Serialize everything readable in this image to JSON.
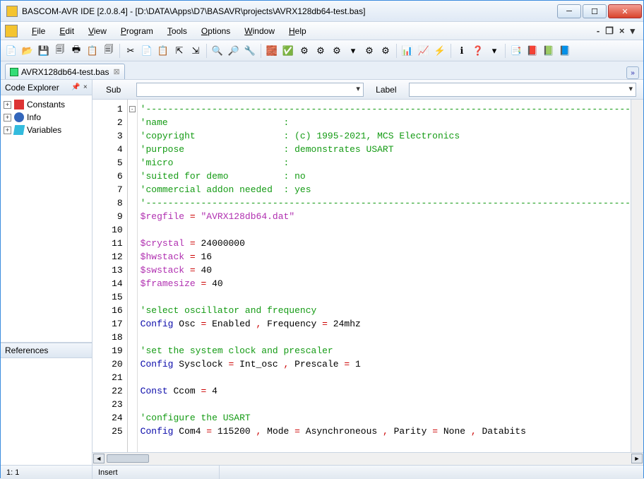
{
  "window": {
    "title": "BASCOM-AVR IDE [2.0.8.4] - [D:\\DATA\\Apps\\D7\\BASAVR\\projects\\AVRX128db64-test.bas]"
  },
  "menu": {
    "items": [
      "File",
      "Edit",
      "View",
      "Program",
      "Tools",
      "Options",
      "Window",
      "Help"
    ]
  },
  "tab": {
    "filename": "AVRX128db64-test.bas"
  },
  "explorer": {
    "title": "Code Explorer",
    "nodes": [
      "Constants",
      "Info",
      "Variables"
    ],
    "refs_title": "References"
  },
  "subbar": {
    "sub": "Sub",
    "label": "Label"
  },
  "code_lines": [
    {
      "n": 1,
      "seg": [
        {
          "t": "'----------------------------------------------------------------------------------------",
          "c": "c-comment"
        }
      ]
    },
    {
      "n": 2,
      "seg": [
        {
          "t": "'name                     :",
          "c": "c-comment"
        }
      ]
    },
    {
      "n": 3,
      "seg": [
        {
          "t": "'copyright                : (c) 1995-2021, MCS Electronics",
          "c": "c-comment"
        }
      ]
    },
    {
      "n": 4,
      "seg": [
        {
          "t": "'purpose                  : demonstrates USART",
          "c": "c-comment"
        }
      ]
    },
    {
      "n": 5,
      "seg": [
        {
          "t": "'micro                    :",
          "c": "c-comment"
        }
      ]
    },
    {
      "n": 6,
      "seg": [
        {
          "t": "'suited for demo          : no",
          "c": "c-comment"
        }
      ]
    },
    {
      "n": 7,
      "seg": [
        {
          "t": "'commercial addon needed  : yes",
          "c": "c-comment"
        }
      ]
    },
    {
      "n": 8,
      "seg": [
        {
          "t": "'----------------------------------------------------------------------------------------",
          "c": "c-comment"
        }
      ]
    },
    {
      "n": 9,
      "seg": [
        {
          "t": "$regfile",
          "c": "c-dir"
        },
        {
          "t": " = ",
          "c": "c-op"
        },
        {
          "t": "\"AVRX128db64.dat\"",
          "c": "c-str"
        }
      ]
    },
    {
      "n": 10,
      "seg": []
    },
    {
      "n": 11,
      "seg": [
        {
          "t": "$crystal",
          "c": "c-dir"
        },
        {
          "t": " = ",
          "c": "c-op"
        },
        {
          "t": "24000000",
          "c": "c-num"
        }
      ]
    },
    {
      "n": 12,
      "seg": [
        {
          "t": "$hwstack",
          "c": "c-dir"
        },
        {
          "t": " = ",
          "c": "c-op"
        },
        {
          "t": "16",
          "c": "c-num"
        }
      ]
    },
    {
      "n": 13,
      "seg": [
        {
          "t": "$swstack",
          "c": "c-dir"
        },
        {
          "t": " = ",
          "c": "c-op"
        },
        {
          "t": "40",
          "c": "c-num"
        }
      ]
    },
    {
      "n": 14,
      "seg": [
        {
          "t": "$framesize",
          "c": "c-dir"
        },
        {
          "t": " = ",
          "c": "c-op"
        },
        {
          "t": "40",
          "c": "c-num"
        }
      ]
    },
    {
      "n": 15,
      "seg": []
    },
    {
      "n": 16,
      "seg": [
        {
          "t": "'select oscillator and frequency",
          "c": "c-comment"
        }
      ]
    },
    {
      "n": 17,
      "seg": [
        {
          "t": "Config",
          "c": "c-kw"
        },
        {
          "t": " Osc ",
          "c": ""
        },
        {
          "t": "=",
          "c": "c-op"
        },
        {
          "t": " Enabled ",
          "c": ""
        },
        {
          "t": ",",
          "c": "c-op"
        },
        {
          "t": " Frequency ",
          "c": ""
        },
        {
          "t": "=",
          "c": "c-op"
        },
        {
          "t": " 24mhz",
          "c": ""
        }
      ]
    },
    {
      "n": 18,
      "seg": []
    },
    {
      "n": 19,
      "seg": [
        {
          "t": "'set the system clock and prescaler",
          "c": "c-comment"
        }
      ]
    },
    {
      "n": 20,
      "seg": [
        {
          "t": "Config",
          "c": "c-kw"
        },
        {
          "t": " Sysclock ",
          "c": ""
        },
        {
          "t": "=",
          "c": "c-op"
        },
        {
          "t": " Int_osc ",
          "c": ""
        },
        {
          "t": ",",
          "c": "c-op"
        },
        {
          "t": " Prescale ",
          "c": ""
        },
        {
          "t": "=",
          "c": "c-op"
        },
        {
          "t": " 1",
          "c": ""
        }
      ]
    },
    {
      "n": 21,
      "seg": []
    },
    {
      "n": 22,
      "seg": [
        {
          "t": "Const",
          "c": "c-kw"
        },
        {
          "t": " Ccom ",
          "c": ""
        },
        {
          "t": "=",
          "c": "c-op"
        },
        {
          "t": " 4",
          "c": ""
        }
      ]
    },
    {
      "n": 23,
      "seg": []
    },
    {
      "n": 24,
      "seg": [
        {
          "t": "'configure the USART",
          "c": "c-comment"
        }
      ]
    },
    {
      "n": 25,
      "seg": [
        {
          "t": "Config",
          "c": "c-kw"
        },
        {
          "t": " Com4 ",
          "c": ""
        },
        {
          "t": "=",
          "c": "c-op"
        },
        {
          "t": " 115200 ",
          "c": ""
        },
        {
          "t": ",",
          "c": "c-op"
        },
        {
          "t": " Mode ",
          "c": ""
        },
        {
          "t": "=",
          "c": "c-op"
        },
        {
          "t": " Asynchroneous ",
          "c": ""
        },
        {
          "t": ",",
          "c": "c-op"
        },
        {
          "t": " Parity ",
          "c": ""
        },
        {
          "t": "=",
          "c": "c-op"
        },
        {
          "t": " None ",
          "c": ""
        },
        {
          "t": ",",
          "c": "c-op"
        },
        {
          "t": " Databits",
          "c": ""
        }
      ]
    }
  ],
  "status": {
    "pos": "1: 1",
    "mode": "Insert"
  },
  "toolbar_icons": [
    "📄",
    "📂",
    "💾",
    "🗐",
    "🖶",
    "📋",
    "🗐",
    "",
    "✂",
    "📄",
    "📋",
    "⇱",
    "⇲",
    "",
    "🔍",
    "🔎",
    "🔧",
    "",
    "🧱",
    "✅",
    "⚙",
    "⚙",
    "⚙",
    "▾",
    "⚙",
    "⚙",
    "",
    "📊",
    "📈",
    "⚡",
    "",
    "ℹ",
    "❓",
    "▾",
    "",
    "📑",
    "📕",
    "📗",
    "📘"
  ]
}
